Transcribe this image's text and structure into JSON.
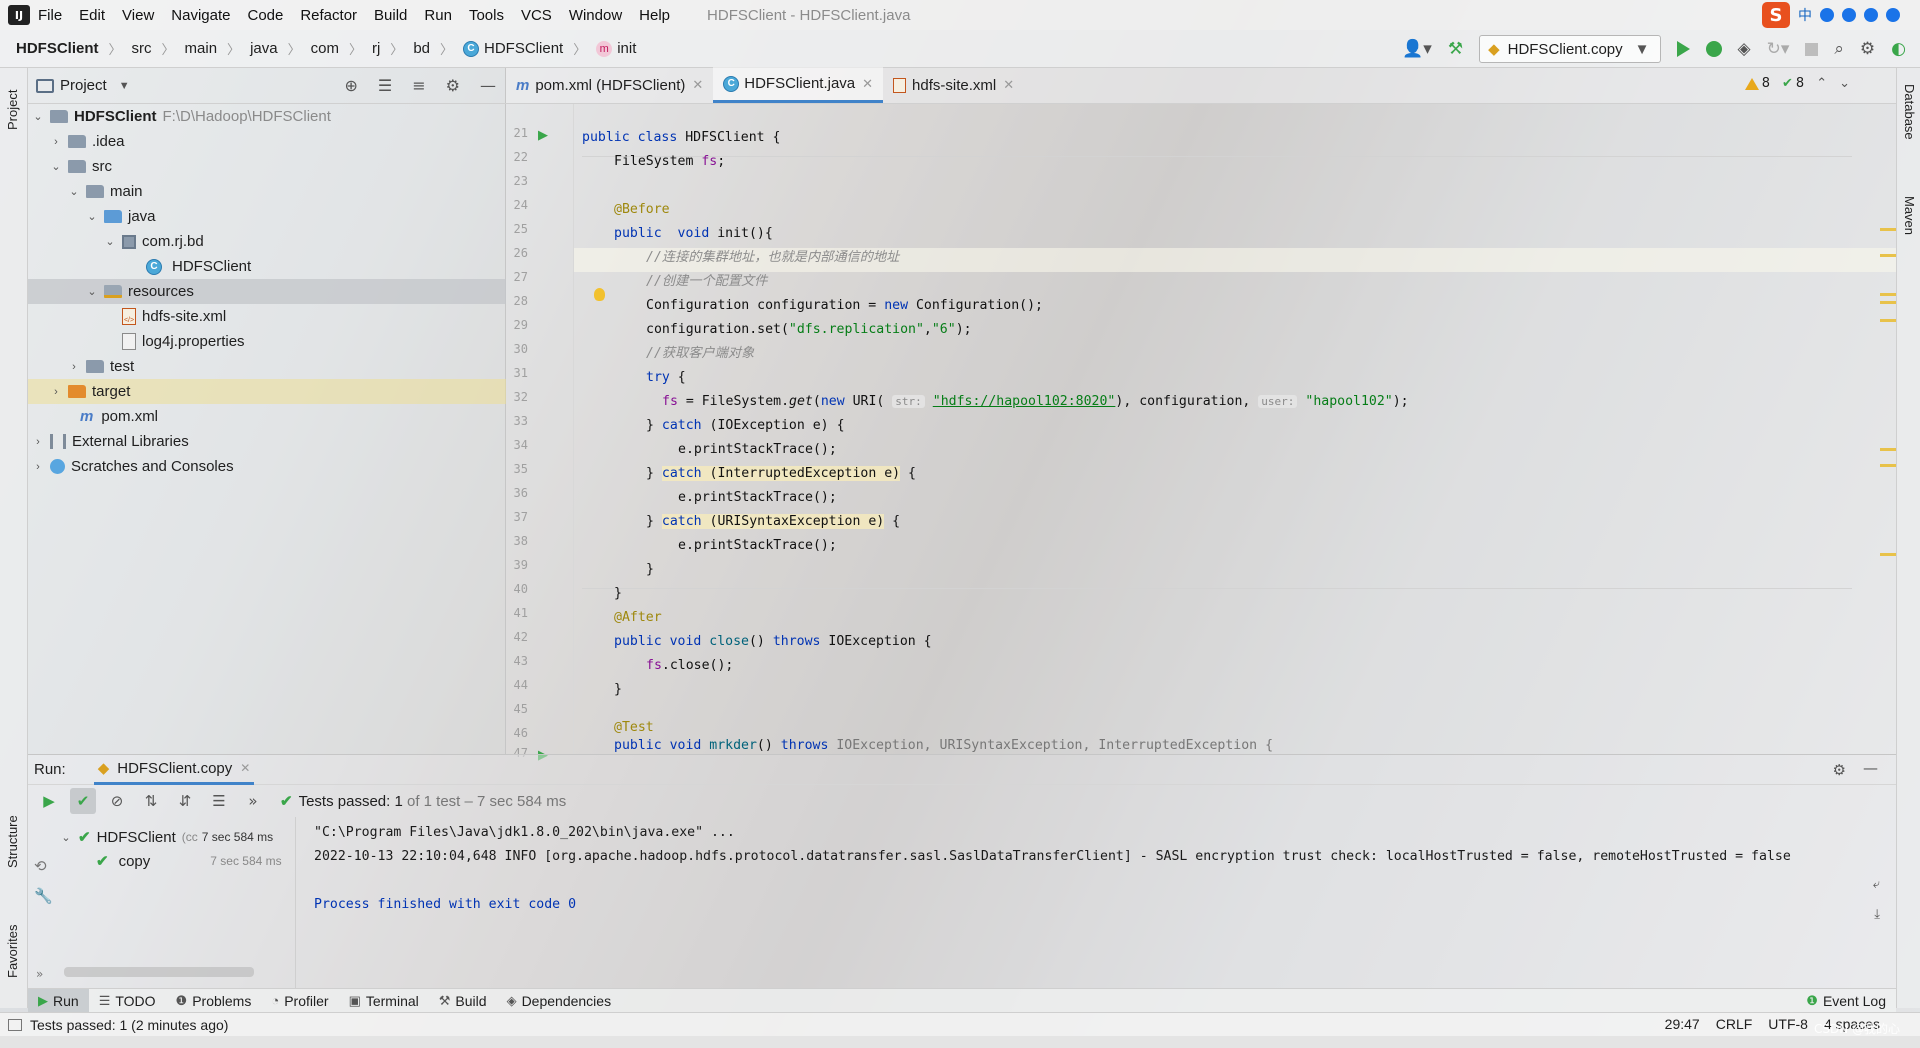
{
  "menu": {
    "items": [
      "File",
      "Edit",
      "View",
      "Navigate",
      "Code",
      "Refactor",
      "Build",
      "Run",
      "Tools",
      "VCS",
      "Window",
      "Help"
    ],
    "window_title": "HDFSClient - HDFSClient.java"
  },
  "ime": {
    "label": "中"
  },
  "navbar": {
    "crumbs": [
      "HDFSClient",
      "src",
      "main",
      "java",
      "com",
      "rj",
      "bd",
      "HDFSClient",
      "init"
    ],
    "run_config": "HDFSClient.copy"
  },
  "side": {
    "project": "Project",
    "structure": "Structure",
    "favorites": "Favorites",
    "database": "Database",
    "maven": "Maven"
  },
  "project": {
    "title": "Project",
    "root_name": "HDFSClient",
    "root_path": "F:\\D\\Hadoop\\HDFSClient",
    "nodes": [
      ".idea",
      "src",
      "main",
      "java",
      "com.rj.bd",
      "HDFSClient",
      "resources",
      "hdfs-site.xml",
      "log4j.properties",
      "test",
      "target",
      "pom.xml",
      "External Libraries",
      "Scratches and Consoles"
    ]
  },
  "editor": {
    "tabs": [
      "pom.xml (HDFSClient)",
      "HDFSClient.java",
      "hdfs-site.xml"
    ],
    "warnings": "8",
    "checks": "8",
    "line_numbers": [
      "21",
      "22",
      "23",
      "24",
      "25",
      "26",
      "27",
      "28",
      "29",
      "30",
      "31",
      "32",
      "33",
      "34",
      "35",
      "36",
      "37",
      "38",
      "39",
      "40",
      "41",
      "42",
      "43",
      "44",
      "45",
      "46",
      "47"
    ],
    "code": {
      "l21_kw": "public class ",
      "l21_rest": "HDFSClient {",
      "l22": "FileSystem ",
      "l22_f": "fs",
      "l24": "@Before",
      "l25_kw": "public  void ",
      "l25_rest": "init(){",
      "l26": "//连接的集群地址，也就是内部通信的地址",
      "l27": "//创建一个配置文件",
      "l28_a": "Configuration configuration = ",
      "l28_kw": "new ",
      "l28_b": "Configuration();",
      "l29_a": "configuration.set(",
      "l29_s1": "\"dfs.replication\"",
      "l29_c": ",",
      "l29_s2": "\"6\"",
      "l29_b": ");",
      "l30": "//获取客户端对象",
      "l31_kw": "try",
      "l31_b": " {",
      "l32_f": "fs",
      "l32_a": " = FileSystem.",
      "l32_m": "get",
      "l32_b": "(",
      "l32_kw": "new ",
      "l32_c": "URI( ",
      "l32_h1": "str:",
      "l32_s1": "\"hdfs://hapool102:8020\"",
      "l32_d": "), configuration, ",
      "l32_h2": "user:",
      "l32_s2": "\"hapool102\"",
      "l32_e": ");",
      "l33_a": "} ",
      "l33_kw": "catch",
      "l33_b": " (IOException e) {",
      "l34": "e.printStackTrace();",
      "l35_a": "} ",
      "l35_kw": "catch",
      "l35_b": " (InterruptedException e)",
      "l35_c": " {",
      "l36": "e.printStackTrace();",
      "l37_a": "} ",
      "l37_kw": "catch",
      "l37_b": " (URISyntaxException e)",
      "l37_c": " {",
      "l38": "e.printStackTrace();",
      "l39": "}",
      "l40": "}",
      "l41": "@After",
      "l42_kw": "public void ",
      "l42_m": "close",
      "l42_a": "() ",
      "l42_kw2": "throws ",
      "l42_b": "IOException {",
      "l43_f": "fs",
      "l43_a": ".close();",
      "l44": "}",
      "l46": "@Test",
      "l47_kw": "public void ",
      "l47_m": "mrkder",
      "l47_a": "() ",
      "l47_kw2": "throws ",
      "l47_b": "IOException, URISyntaxException, InterruptedException {"
    }
  },
  "run": {
    "label": "Run:",
    "tab": "HDFSClient.copy",
    "status_bold": "Tests passed: 1",
    "status_rest": " of 1 test – 7 sec 584 ms",
    "tree": [
      {
        "name": "HDFSClient",
        "extra": "(cc",
        "time": "7 sec 584 ms"
      },
      {
        "name": "copy",
        "time": "7 sec 584 ms"
      }
    ],
    "console": [
      "\"C:\\Program Files\\Java\\jdk1.8.0_202\\bin\\java.exe\" ...",
      "2022-10-13 22:10:04,648 INFO [org.apache.hadoop.hdfs.protocol.datatransfer.sasl.SaslDataTransferClient] - SASL encryption trust check: localHostTrusted = false, remoteHostTrusted = false",
      "",
      "Process finished with exit code 0"
    ]
  },
  "tool_tabs": [
    "Run",
    "TODO",
    "Problems",
    "Profiler",
    "Terminal",
    "Build",
    "Dependencies"
  ],
  "event_log": "Event Log",
  "status": {
    "message": "Tests passed: 1 (2 minutes ago)",
    "position": "29:47",
    "line_sep": "CRLF",
    "encoding": "UTF-8",
    "indent": "4 spaces"
  },
  "watermark": "CSDN @我的心"
}
